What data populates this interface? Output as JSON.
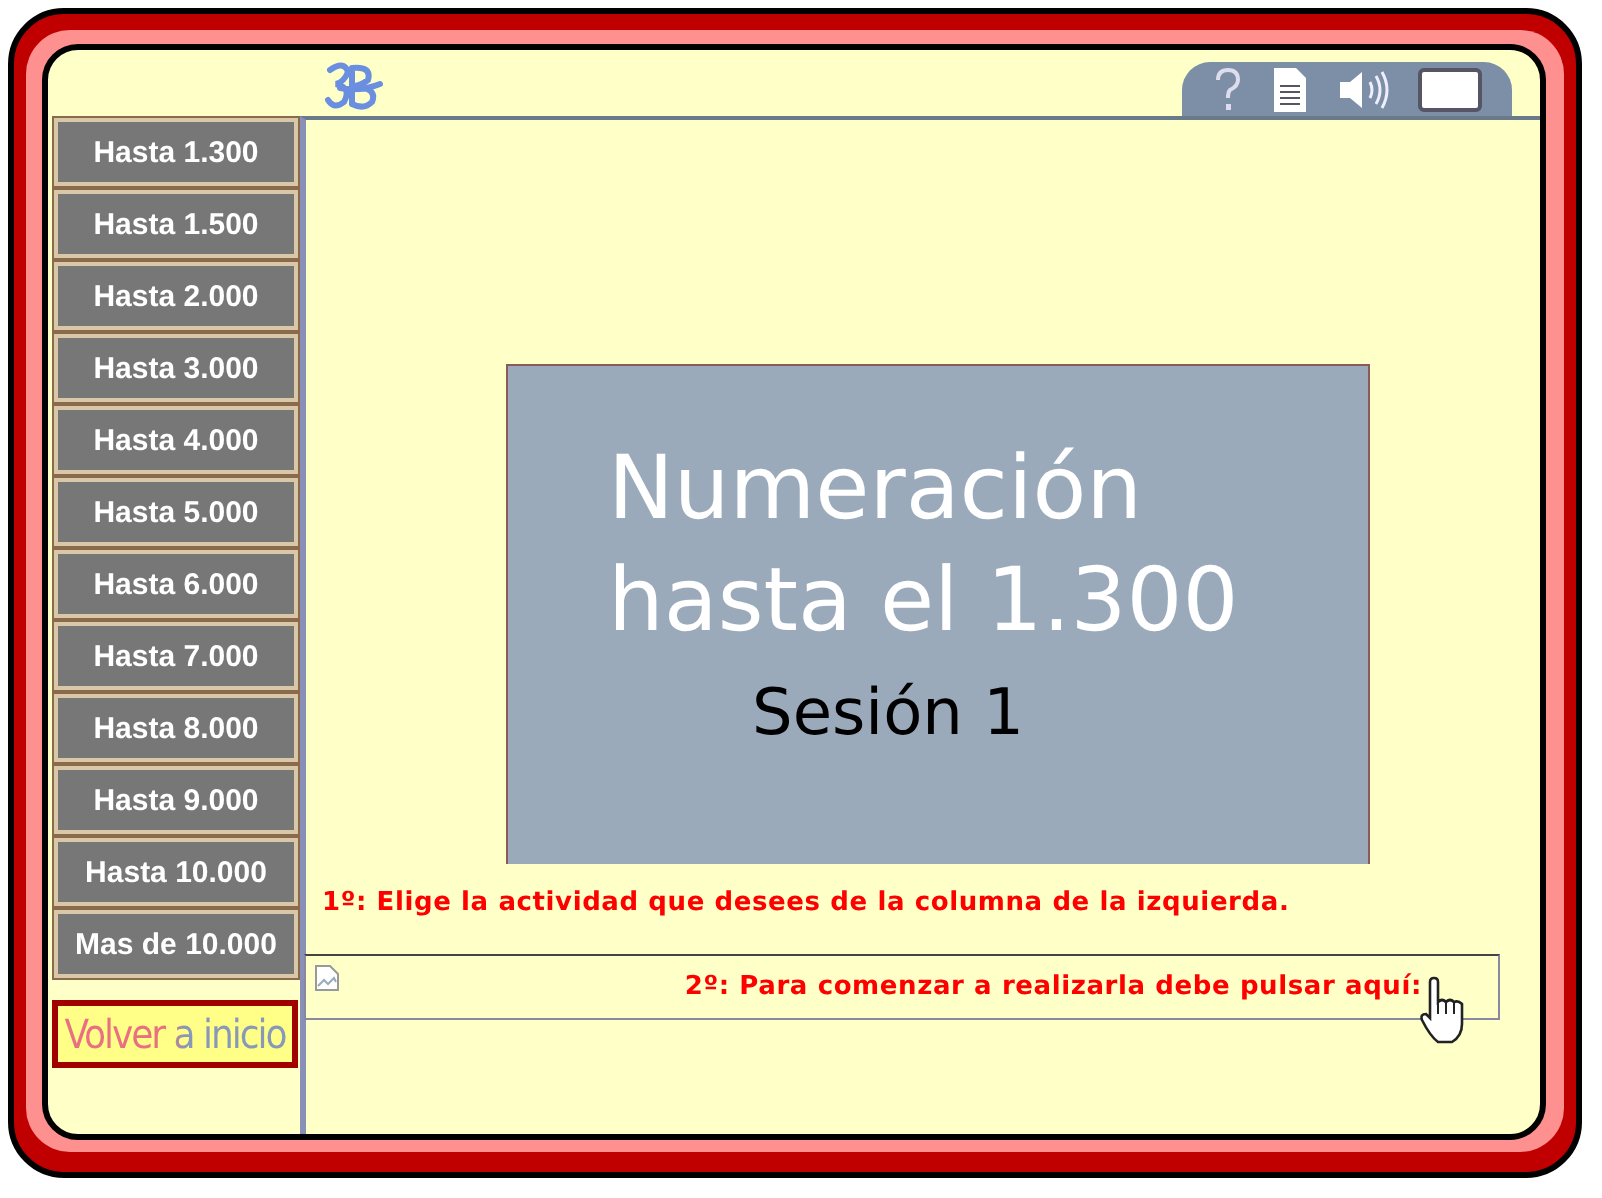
{
  "menu": [
    {
      "label": "Hasta 1.300"
    },
    {
      "label": "Hasta 1.500"
    },
    {
      "label": "Hasta 2.000"
    },
    {
      "label": "Hasta 3.000"
    },
    {
      "label": "Hasta 4.000"
    },
    {
      "label": "Hasta 5.000"
    },
    {
      "label": "Hasta 6.000"
    },
    {
      "label": "Hasta 7.000"
    },
    {
      "label": "Hasta 8.000"
    },
    {
      "label": "Hasta 9.000"
    },
    {
      "label": "Hasta 10.000"
    },
    {
      "label": "Mas de 10.000"
    }
  ],
  "home_button": "Volver a inicio",
  "slide": {
    "title_lines": [
      "Numeración",
      "hasta el 1.300"
    ],
    "subtitle": "Sesión 1"
  },
  "instructions": [
    "1º: Elige la actividad que desees de la columna de la izquierda.",
    "2º: Para comenzar a realizarla debe pulsar aquí:"
  ]
}
